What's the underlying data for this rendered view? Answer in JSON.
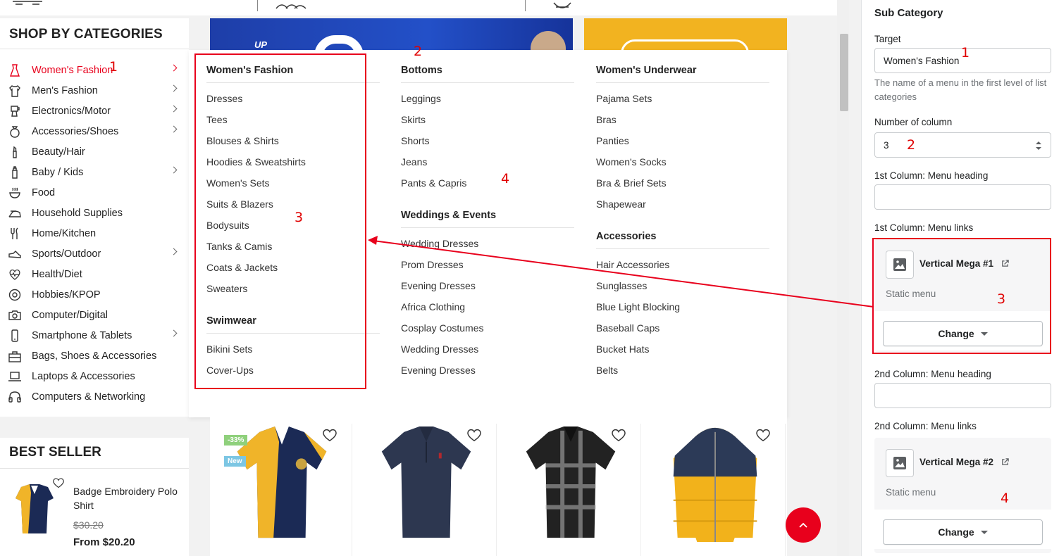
{
  "sidebar": {
    "title": "SHOP BY CATEGORIES",
    "items": [
      {
        "label": "Women's Fashion",
        "icon": "dress-icon",
        "chevron": true,
        "active": true
      },
      {
        "label": "Men's Fashion",
        "icon": "shirt-icon",
        "chevron": true
      },
      {
        "label": "Electronics/Motor",
        "icon": "blender-icon",
        "chevron": true
      },
      {
        "label": "Accessories/Shoes",
        "icon": "ring-icon",
        "chevron": true
      },
      {
        "label": "Beauty/Hair",
        "icon": "lipstick-icon",
        "chevron": false
      },
      {
        "label": "Baby / Kids",
        "icon": "baby-bottle-icon",
        "chevron": true
      },
      {
        "label": "Food",
        "icon": "bowl-icon",
        "chevron": false
      },
      {
        "label": "Household Supplies",
        "icon": "iron-icon",
        "chevron": false
      },
      {
        "label": "Home/Kitchen",
        "icon": "utensils-icon",
        "chevron": false
      },
      {
        "label": "Sports/Outdoor",
        "icon": "sneaker-icon",
        "chevron": true
      },
      {
        "label": "Health/Diet",
        "icon": "heartbeat-icon",
        "chevron": false
      },
      {
        "label": "Hobbies/KPOP",
        "icon": "disc-icon",
        "chevron": false
      },
      {
        "label": "Computer/Digital",
        "icon": "camera-icon",
        "chevron": false
      },
      {
        "label": "Smartphone & Tablets",
        "icon": "smartphone-icon",
        "chevron": true
      },
      {
        "label": "Bags, Shoes & Accessories",
        "icon": "bag-icon",
        "chevron": false
      },
      {
        "label": "Laptops & Accessories",
        "icon": "laptop-icon",
        "chevron": false
      },
      {
        "label": "Computers & Networking",
        "icon": "headphones-icon",
        "chevron": false
      }
    ]
  },
  "mega_menu": {
    "columns": [
      {
        "groups": [
          {
            "heading": "Women's Fashion",
            "links": [
              "Dresses",
              "Tees",
              "Blouses & Shirts",
              "Hoodies & Sweatshirts",
              "Women's Sets",
              "Suits & Blazers",
              "Bodysuits",
              "Tanks & Camis",
              "Coats & Jackets",
              "Sweaters"
            ]
          },
          {
            "heading": "Swimwear",
            "links": [
              "Bikini Sets",
              "Cover-Ups"
            ]
          }
        ]
      },
      {
        "groups": [
          {
            "heading": "Bottoms",
            "links": [
              "Leggings",
              "Skirts",
              "Shorts",
              "Jeans",
              "Pants & Capris"
            ]
          },
          {
            "heading": "Weddings & Events",
            "links": [
              "Wedding Dresses",
              "Prom Dresses",
              "Evening Dresses",
              "Africa Clothing",
              "Cosplay Costumes",
              "Wedding Dresses",
              "Evening Dresses"
            ]
          }
        ]
      },
      {
        "groups": [
          {
            "heading": "Women's Underwear",
            "links": [
              "Pajama Sets",
              "Bras",
              "Panties",
              "Women's Socks",
              "Bra & Brief Sets",
              "Shapewear"
            ]
          },
          {
            "heading": "Accessories",
            "links": [
              "Hair Accessories",
              "Sunglasses",
              "Blue Light Blocking",
              "Baseball Caps",
              "Bucket Hats",
              "Belts"
            ]
          }
        ]
      }
    ]
  },
  "banner": {
    "text": "UP"
  },
  "products": [
    {
      "image": "polo-shirt-navy-yellow",
      "badges": [
        "-33%",
        "New"
      ]
    },
    {
      "image": "polo-shirt-navy",
      "badges": []
    },
    {
      "image": "polo-shirt-plaid-black",
      "badges": []
    },
    {
      "image": "puffer-jacket-yellow-navy",
      "badges": []
    }
  ],
  "best_seller": {
    "title": "BEST SELLER",
    "item": {
      "name": "Badge Embroidery Polo Shirt",
      "old_price": "$30.20",
      "price": "From $20.20"
    }
  },
  "panel": {
    "section_title": "Sub Category",
    "target_label": "Target",
    "target_value": "Women's Fashion",
    "target_help": "The name of a menu in the first level of list categories",
    "columns_label": "Number of column",
    "columns_value": "3",
    "col1_heading_label": "1st Column: Menu heading",
    "col1_heading_value": "",
    "col1_links_label": "1st Column: Menu links",
    "col1_menu_title": "Vertical Mega #1",
    "col1_menu_sub": "Static menu",
    "col2_heading_label": "2nd Column: Menu heading",
    "col2_heading_value": "",
    "col2_links_label": "2nd Column: Menu links",
    "col2_menu_title": "Vertical Mega #2",
    "col2_menu_sub": "Static menu",
    "change_label": "Change"
  },
  "annotations": {
    "n1": "1",
    "n2": "2",
    "n3": "3",
    "n4": "4"
  },
  "colors": {
    "accent": "#e8001c",
    "annotation": "#e00000"
  }
}
